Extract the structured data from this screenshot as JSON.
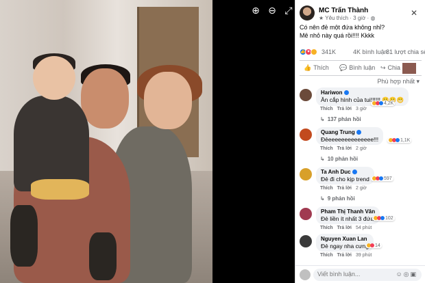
{
  "viewer": {
    "tools": [
      {
        "icon": "zoom-in-icon",
        "glyph": "⊕"
      },
      {
        "icon": "zoom-out-icon",
        "glyph": "⊖"
      },
      {
        "icon": "fullscreen-icon",
        "glyph": "⤢"
      }
    ]
  },
  "post": {
    "author": "MC Trấn Thành",
    "follow_label": "Yêu thích",
    "time": "3 giờ",
    "caption_line1": "Có nên đẻ một đứa không nhỉ?",
    "caption_line2": "Mê nhỏ này quá rồi!!!! Kkkk",
    "reaction_count": "341K",
    "comment_count": "4K bình luận",
    "share_count": "81 lượt chia sẻ"
  },
  "actions": {
    "like_label": "Thích",
    "comment_label": "Bình luận",
    "share_label": "Chia sẻ"
  },
  "sort_label": "Phù hợp nhất",
  "comments": [
    {
      "name": "Hariwon",
      "text": "Ăn cắp hình của tui!!!!!! 😬😬😬",
      "reacts": "4,2K",
      "like": "Thích",
      "reply": "Trả lời",
      "time": "3 giờ",
      "replies": "137 phản hồi",
      "avatar_color": "#6b4a3a"
    },
    {
      "name": "Quang Trung",
      "text": "Đẻeeeeeeeeeeeeee!!!",
      "reacts": "1,1K",
      "like": "Thích",
      "reply": "Trả lời",
      "time": "2 giờ",
      "replies": "10 phản hồi",
      "avatar_color": "#c24a1e"
    },
    {
      "name": "Ta Anh Duc",
      "text": "Đẻ đi cho kịp trend",
      "reacts": "597",
      "like": "Thích",
      "reply": "Trả lời",
      "time": "2 giờ",
      "replies": "9 phản hồi",
      "avatar_color": "#d8a02a"
    },
    {
      "name": "Pham Thị Thanh Vân",
      "text": "Đẻ liền ít nhất 3 đứa!",
      "reacts": "102",
      "like": "Thích",
      "reply": "Trả lời",
      "time": "54 phút",
      "replies": "",
      "avatar_color": "#a03a50"
    },
    {
      "name": "Nguyen Xuan Lan",
      "text": "Đẻ ngay nha cưng",
      "reacts": "14",
      "like": "Thích",
      "reply": "Trả lời",
      "time": "39 phút",
      "replies": "",
      "avatar_color": "#3a3a3a"
    }
  ],
  "compose": {
    "placeholder": "Viết bình luận..."
  }
}
